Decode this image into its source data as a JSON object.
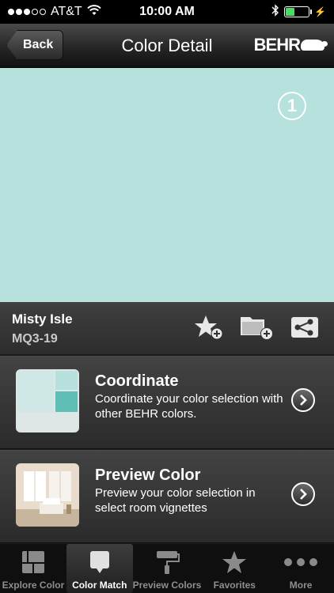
{
  "status_bar": {
    "carrier": "AT&T",
    "time": "10:00 AM",
    "signal_dots_filled": 3,
    "signal_dots_total": 5,
    "battery_level_percent": 40
  },
  "nav": {
    "back_label": "Back",
    "title": "Color Detail",
    "brand": "BEHR"
  },
  "swatch": {
    "color": "#b6e1dc",
    "badge": "1"
  },
  "color_info": {
    "name": "Misty Isle",
    "code": "MQ3-19"
  },
  "actions": {
    "favorite_icon": "star-add-icon",
    "folder_icon": "folder-add-icon",
    "share_icon": "share-icon"
  },
  "cards": {
    "coordinate": {
      "title": "Coordinate",
      "description": "Coordinate your color selection with other BEHR colors.",
      "swatch_colors": [
        "#cfe8e5",
        "#b7e0dd",
        "#5ebdb4",
        "#dfe6e6"
      ]
    },
    "preview": {
      "title": "Preview Color",
      "description": "Preview your color selection in select room vignettes"
    }
  },
  "tabs": [
    {
      "label": "Explore Color",
      "icon": "explore-color-icon",
      "active": false
    },
    {
      "label": "Color Match",
      "icon": "color-match-icon",
      "active": true
    },
    {
      "label": "Preview Colors",
      "icon": "paint-roller-icon",
      "active": false
    },
    {
      "label": "Favorites",
      "icon": "star-icon",
      "active": false
    },
    {
      "label": "More",
      "icon": "more-dots-icon",
      "active": false
    }
  ],
  "colors": {
    "accent_green": "#4cd964",
    "text_gray": "#c9c9c9"
  }
}
